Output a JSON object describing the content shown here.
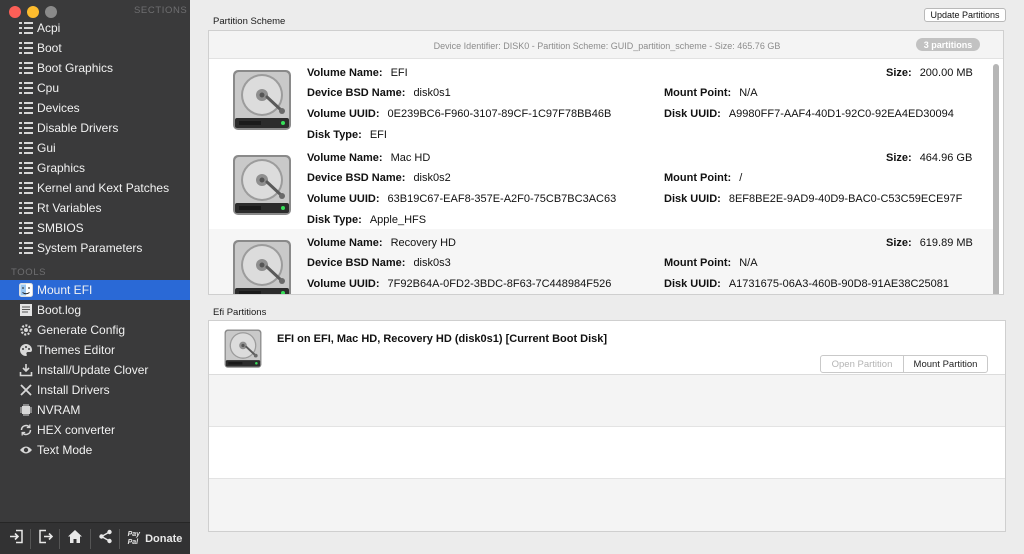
{
  "sidebar": {
    "sections_header": "SECTIONS",
    "tools_header": "TOOLS",
    "sections": [
      {
        "label": "Acpi"
      },
      {
        "label": "Boot"
      },
      {
        "label": "Boot Graphics"
      },
      {
        "label": "Cpu"
      },
      {
        "label": "Devices"
      },
      {
        "label": "Disable Drivers"
      },
      {
        "label": "Gui"
      },
      {
        "label": "Graphics"
      },
      {
        "label": "Kernel and Kext Patches"
      },
      {
        "label": "Rt Variables"
      },
      {
        "label": "SMBIOS"
      },
      {
        "label": "System Parameters"
      }
    ],
    "tools": [
      {
        "label": "Mount EFI",
        "icon": "finder-icon",
        "selected": true
      },
      {
        "label": "Boot.log",
        "icon": "log-file-icon"
      },
      {
        "label": "Generate Config",
        "icon": "gear-icon"
      },
      {
        "label": "Themes Editor",
        "icon": "palette-icon"
      },
      {
        "label": "Install/Update Clover",
        "icon": "download-icon"
      },
      {
        "label": "Install Drivers",
        "icon": "tools-icon"
      },
      {
        "label": "NVRAM",
        "icon": "chip-icon"
      },
      {
        "label": "HEX converter",
        "icon": "refresh-icon"
      },
      {
        "label": "Text Mode",
        "icon": "eye-icon"
      }
    ],
    "bottom_bar": {
      "paypal_text_1": "Pay",
      "paypal_text_2": "Pal",
      "donate_label": "Donate"
    }
  },
  "main": {
    "partition_scheme_label": "Partition Scheme",
    "update_button_label": "Update Partitions",
    "scheme_header": "Device Identifier: DISK0 - Partition Scheme: GUID_partition_scheme - Size: 465.76 GB",
    "partitions_badge": "3 partitions",
    "field_labels": {
      "volume_name": "Volume Name:",
      "device_bsd": "Device BSD Name:",
      "volume_uuid": "Volume UUID:",
      "disk_type": "Disk Type:",
      "size": "Size:",
      "mount_point": "Mount Point:",
      "disk_uuid": "Disk UUID:"
    },
    "partitions": [
      {
        "volume_name": "EFI",
        "device_bsd": "disk0s1",
        "volume_uuid": "0E239BC6-F960-3107-89CF-1C97F78BB46B",
        "disk_type": "EFI",
        "size": "200.00 MB",
        "mount_point": "N/A",
        "disk_uuid": "A9980FF7-AAF4-40D1-92C0-92EA4ED30094"
      },
      {
        "volume_name": "Mac HD",
        "device_bsd": "disk0s2",
        "volume_uuid": "63B19C67-EAF8-357E-A2F0-75CB7BC3AC63",
        "disk_type": "Apple_HFS",
        "size": "464.96 GB",
        "mount_point": "/",
        "disk_uuid": "8EF8BE2E-9AD9-40D9-BAC0-C53C59ECE97F"
      },
      {
        "volume_name": "Recovery HD",
        "device_bsd": "disk0s3",
        "volume_uuid": "7F92B64A-0FD2-3BDC-8F63-7C448984F526",
        "size": "619.89 MB",
        "mount_point": "N/A",
        "disk_uuid": "A1731675-06A3-460B-90D8-91AE38C25081"
      }
    ],
    "efi_label": "Efi Partitions",
    "efi_entry_title": "EFI on EFI, Mac HD, Recovery HD (disk0s1) [Current Boot Disk]",
    "open_partition_label": "Open Partition",
    "mount_partition_label": "Mount Partition"
  },
  "colors": {
    "sidebar_bg": "#3a3a3b",
    "selection_blue": "#2a69d6",
    "badge_gray": "#c2c2c2"
  }
}
